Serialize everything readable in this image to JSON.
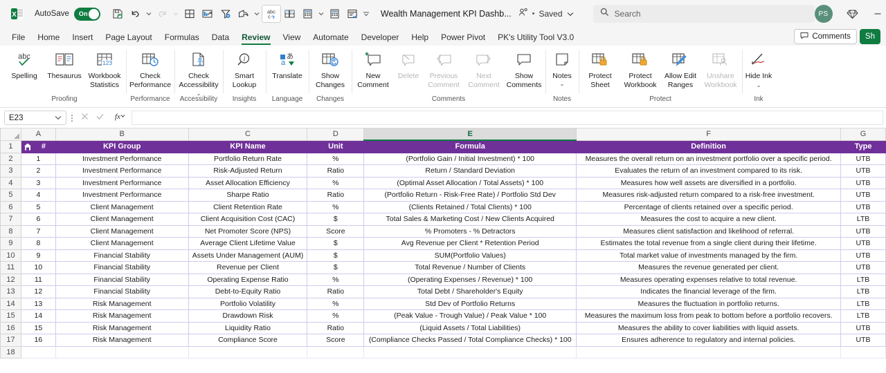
{
  "titlebar": {
    "autosave_label": "AutoSave",
    "autosave_state": "On",
    "document_title": "Wealth Management KPI Dashb...",
    "saved_status": "Saved",
    "separator_dot": "•",
    "search_placeholder": "Search",
    "avatar_initials": "PS",
    "quick_access": [
      {
        "name": "save-icon",
        "label": "Save"
      },
      {
        "name": "undo-icon",
        "label": "Undo"
      },
      {
        "name": "redo-icon",
        "label": "Redo"
      },
      {
        "name": "borders-icon",
        "label": "Borders"
      },
      {
        "name": "chart-icon",
        "label": "Insert Chart"
      },
      {
        "name": "filter-icon",
        "label": "Filter"
      },
      {
        "name": "share-arrow-icon",
        "label": "Share"
      },
      {
        "name": "spelling-abc-icon",
        "label": "Spelling"
      },
      {
        "name": "freeze-panes-icon",
        "label": "Freeze Panes"
      },
      {
        "name": "calculator-icon",
        "label": "Calculate"
      },
      {
        "name": "calculator-sheet-icon",
        "label": "Calculate Sheet"
      },
      {
        "name": "form-icon",
        "label": "Form"
      },
      {
        "name": "customize-qat-icon",
        "label": "Customize Quick Access Toolbar"
      }
    ]
  },
  "tabs": [
    {
      "label": "File",
      "active": false
    },
    {
      "label": "Home",
      "active": false
    },
    {
      "label": "Insert",
      "active": false
    },
    {
      "label": "Page Layout",
      "active": false
    },
    {
      "label": "Formulas",
      "active": false
    },
    {
      "label": "Data",
      "active": false
    },
    {
      "label": "Review",
      "active": true
    },
    {
      "label": "View",
      "active": false
    },
    {
      "label": "Automate",
      "active": false
    },
    {
      "label": "Developer",
      "active": false
    },
    {
      "label": "Help",
      "active": false
    },
    {
      "label": "Power Pivot",
      "active": false
    },
    {
      "label": "PK's Utility Tool V3.0",
      "active": false
    }
  ],
  "tabs_right": {
    "comments_label": "Comments",
    "share_label": "Sh"
  },
  "ribbon": {
    "groups": [
      {
        "name": "Proofing",
        "buttons": [
          {
            "label": "Spelling",
            "icon": "abc-check-icon",
            "disabled": false,
            "caret": false
          },
          {
            "label": "Thesaurus",
            "icon": "book-icon",
            "disabled": false,
            "caret": false
          },
          {
            "label": "Workbook Statistics",
            "icon": "workbook-stats-icon",
            "disabled": false,
            "caret": false
          }
        ]
      },
      {
        "name": "Performance",
        "buttons": [
          {
            "label": "Check Performance",
            "icon": "check-performance-icon",
            "disabled": false,
            "caret": false
          }
        ]
      },
      {
        "name": "Accessibility",
        "buttons": [
          {
            "label": "Check Accessibility",
            "icon": "accessibility-icon",
            "disabled": false,
            "caret": true
          }
        ]
      },
      {
        "name": "Insights",
        "buttons": [
          {
            "label": "Smart Lookup",
            "icon": "smart-lookup-icon",
            "disabled": false,
            "caret": false
          }
        ]
      },
      {
        "name": "Language",
        "buttons": [
          {
            "label": "Translate",
            "icon": "translate-icon",
            "disabled": false,
            "caret": false
          }
        ]
      },
      {
        "name": "Changes",
        "buttons": [
          {
            "label": "Show Changes",
            "icon": "show-changes-icon",
            "disabled": false,
            "caret": false
          }
        ]
      },
      {
        "name": "Comments",
        "buttons": [
          {
            "label": "New Comment",
            "icon": "new-comment-icon",
            "disabled": false,
            "caret": false
          },
          {
            "label": "Delete",
            "icon": "delete-comment-icon",
            "disabled": true,
            "caret": false
          },
          {
            "label": "Previous Comment",
            "icon": "previous-comment-icon",
            "disabled": true,
            "caret": false
          },
          {
            "label": "Next Comment",
            "icon": "next-comment-icon",
            "disabled": true,
            "caret": false
          },
          {
            "label": "Show Comments",
            "icon": "show-comments-icon",
            "disabled": false,
            "caret": false
          }
        ]
      },
      {
        "name": "Notes",
        "buttons": [
          {
            "label": "Notes",
            "icon": "notes-icon",
            "disabled": false,
            "caret": true
          }
        ]
      },
      {
        "name": "Protect",
        "buttons": [
          {
            "label": "Protect Sheet",
            "icon": "protect-sheet-icon",
            "disabled": false,
            "caret": false
          },
          {
            "label": "Protect Workbook",
            "icon": "protect-workbook-icon",
            "disabled": false,
            "caret": false
          },
          {
            "label": "Allow Edit Ranges",
            "icon": "allow-edit-ranges-icon",
            "disabled": false,
            "caret": false
          },
          {
            "label": "Unshare Workbook",
            "icon": "unshare-workbook-icon",
            "disabled": true,
            "caret": false
          }
        ]
      },
      {
        "name": "Ink",
        "buttons": [
          {
            "label": "Hide Ink",
            "icon": "hide-ink-icon",
            "disabled": false,
            "caret": true
          }
        ]
      }
    ]
  },
  "formula_bar": {
    "name_box_value": "E23",
    "formula_value": "",
    "cancel_icon": "cancel-icon",
    "enter_icon": "enter-check-icon",
    "function_icon": "insert-function-icon"
  },
  "grid": {
    "column_letters": [
      "A",
      "B",
      "C",
      "D",
      "E",
      "F",
      "G"
    ],
    "selected_column": "E",
    "row_numbers": [
      "1",
      "2",
      "3",
      "4",
      "5",
      "6",
      "7",
      "8",
      "9",
      "10",
      "11",
      "12",
      "13",
      "14",
      "15",
      "16",
      "17",
      "18"
    ],
    "header_row": {
      "home_icon": "home-icon",
      "cells": [
        "#",
        "KPI Group",
        "KPI Name",
        "Unit",
        "Formula",
        "Definition",
        "Type"
      ]
    },
    "header_bg": "#70309a",
    "rows": [
      {
        "num": "1",
        "group": "Investment Performance",
        "kpi": "Portfolio Return Rate",
        "unit": "%",
        "formula": "(Portfolio Gain / Initial Investment) * 100",
        "definition": "Measures the overall return on an investment portfolio over a specific period.",
        "type": "UTB"
      },
      {
        "num": "2",
        "group": "Investment Performance",
        "kpi": "Risk-Adjusted Return",
        "unit": "Ratio",
        "formula": "Return / Standard Deviation",
        "definition": "Evaluates the return of an investment compared to its risk.",
        "type": "UTB"
      },
      {
        "num": "3",
        "group": "Investment Performance",
        "kpi": "Asset Allocation Efficiency",
        "unit": "%",
        "formula": "(Optimal Asset Allocation / Total Assets) * 100",
        "definition": "Measures how well assets are diversified in a portfolio.",
        "type": "UTB"
      },
      {
        "num": "4",
        "group": "Investment Performance",
        "kpi": "Sharpe Ratio",
        "unit": "Ratio",
        "formula": "(Portfolio Return - Risk-Free Rate) / Portfolio Std Dev",
        "definition": "Measures risk-adjusted return compared to a risk-free investment.",
        "type": "UTB"
      },
      {
        "num": "5",
        "group": "Client Management",
        "kpi": "Client Retention Rate",
        "unit": "%",
        "formula": "(Clients Retained / Total Clients) * 100",
        "definition": "Percentage of clients retained over a specific period.",
        "type": "UTB"
      },
      {
        "num": "6",
        "group": "Client Management",
        "kpi": "Client Acquisition Cost (CAC)",
        "unit": "$",
        "formula": "Total Sales & Marketing Cost / New Clients Acquired",
        "definition": "Measures the cost to acquire a new client.",
        "type": "LTB"
      },
      {
        "num": "7",
        "group": "Client Management",
        "kpi": "Net Promoter Score (NPS)",
        "unit": "Score",
        "formula": "% Promoters - % Detractors",
        "definition": "Measures client satisfaction and likelihood of referral.",
        "type": "UTB"
      },
      {
        "num": "8",
        "group": "Client Management",
        "kpi": "Average Client Lifetime Value",
        "unit": "$",
        "formula": "Avg Revenue per Client * Retention Period",
        "definition": "Estimates the total revenue from a single client during their lifetime.",
        "type": "UTB"
      },
      {
        "num": "9",
        "group": "Financial Stability",
        "kpi": "Assets Under Management (AUM)",
        "unit": "$",
        "formula": "SUM(Portfolio Values)",
        "definition": "Total market value of investments managed by the firm.",
        "type": "UTB"
      },
      {
        "num": "10",
        "group": "Financial Stability",
        "kpi": "Revenue per Client",
        "unit": "$",
        "formula": "Total Revenue / Number of Clients",
        "definition": "Measures the revenue generated per client.",
        "type": "UTB"
      },
      {
        "num": "11",
        "group": "Financial Stability",
        "kpi": "Operating Expense Ratio",
        "unit": "%",
        "formula": "(Operating Expenses / Revenue) * 100",
        "definition": "Measures operating expenses relative to total revenue.",
        "type": "LTB"
      },
      {
        "num": "12",
        "group": "Financial Stability",
        "kpi": "Debt-to-Equity Ratio",
        "unit": "Ratio",
        "formula": "Total Debt / Shareholder's Equity",
        "definition": "Indicates the financial leverage of the firm.",
        "type": "LTB"
      },
      {
        "num": "13",
        "group": "Risk Management",
        "kpi": "Portfolio Volatility",
        "unit": "%",
        "formula": "Std Dev of Portfolio Returns",
        "definition": "Measures the fluctuation in portfolio returns.",
        "type": "LTB"
      },
      {
        "num": "14",
        "group": "Risk Management",
        "kpi": "Drawdown Risk",
        "unit": "%",
        "formula": "(Peak Value - Trough Value) / Peak Value * 100",
        "definition": "Measures the maximum loss from peak to bottom before a portfolio recovers.",
        "type": "LTB"
      },
      {
        "num": "15",
        "group": "Risk Management",
        "kpi": "Liquidity Ratio",
        "unit": "Ratio",
        "formula": "(Liquid Assets / Total Liabilities)",
        "definition": "Measures the ability to cover liabilities with liquid assets.",
        "type": "UTB"
      },
      {
        "num": "16",
        "group": "Risk Management",
        "kpi": "Compliance Score",
        "unit": "Score",
        "formula": "(Compliance Checks Passed / Total Compliance Checks) * 100",
        "definition": "Ensures adherence to regulatory and internal policies.",
        "type": "UTB"
      }
    ]
  }
}
